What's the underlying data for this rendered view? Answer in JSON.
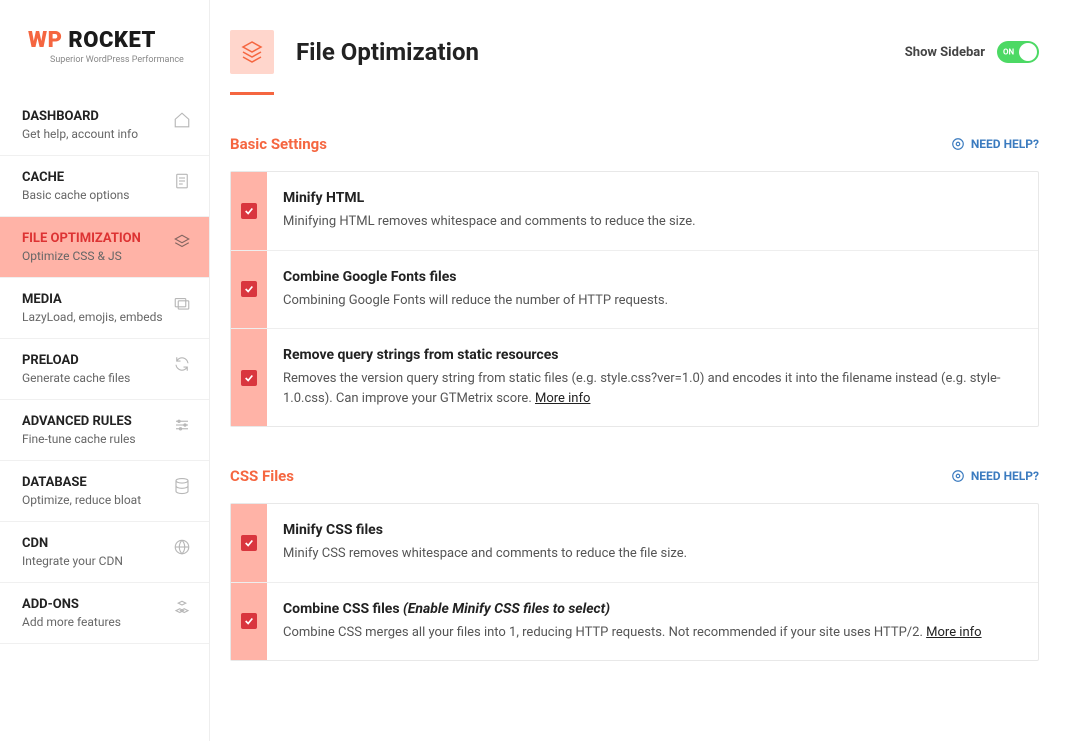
{
  "logo": {
    "wp": "WP",
    "rocket": " ROCKET",
    "tagline": "Superior WordPress Performance"
  },
  "nav": [
    {
      "title": "DASHBOARD",
      "sub": "Get help, account info",
      "icon": "home"
    },
    {
      "title": "CACHE",
      "sub": "Basic cache options",
      "icon": "doc"
    },
    {
      "title": "FILE OPTIMIZATION",
      "sub": "Optimize CSS & JS",
      "icon": "layers",
      "active": true
    },
    {
      "title": "MEDIA",
      "sub": "LazyLoad, emojis, embeds",
      "icon": "images"
    },
    {
      "title": "PRELOAD",
      "sub": "Generate cache files",
      "icon": "refresh"
    },
    {
      "title": "ADVANCED RULES",
      "sub": "Fine-tune cache rules",
      "icon": "sliders"
    },
    {
      "title": "DATABASE",
      "sub": "Optimize, reduce bloat",
      "icon": "db"
    },
    {
      "title": "CDN",
      "sub": "Integrate your CDN",
      "icon": "globe"
    },
    {
      "title": "ADD-ONS",
      "sub": "Add more features",
      "icon": "cubes"
    }
  ],
  "header": {
    "title": "File Optimization",
    "show_sidebar": "Show Sidebar",
    "toggle": "ON"
  },
  "help": "NEED HELP?",
  "sections": {
    "basic": {
      "title": "Basic Settings",
      "rows": [
        {
          "title": "Minify HTML",
          "desc": "Minifying HTML removes whitespace and comments to reduce the size.",
          "checked": true
        },
        {
          "title": "Combine Google Fonts files",
          "desc": "Combining Google Fonts will reduce the number of HTTP requests.",
          "checked": true
        },
        {
          "title": "Remove query strings from static resources",
          "desc": "Removes the version query string from static files (e.g. style.css?ver=1.0) and encodes it into the filename instead (e.g. style-1.0.css). Can improve your GTMetrix score. ",
          "more": "More info",
          "checked": true
        }
      ]
    },
    "css": {
      "title": "CSS Files",
      "rows": [
        {
          "title": "Minify CSS files",
          "desc": "Minify CSS removes whitespace and comments to reduce the file size.",
          "checked": true
        },
        {
          "title": "Combine CSS files ",
          "hint": "(Enable Minify CSS files to select)",
          "desc": "Combine CSS merges all your files into 1, reducing HTTP requests. Not recommended if your site uses HTTP/2. ",
          "more": "More info",
          "checked": true
        }
      ]
    }
  }
}
